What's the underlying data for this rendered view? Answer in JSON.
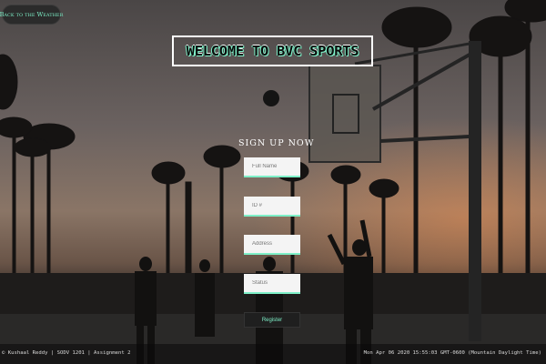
{
  "nav": {
    "back_label": "Back to the Weather"
  },
  "header": {
    "title": "WELCOME TO BVC SPORTS"
  },
  "form": {
    "title": "SIGN UP NOW",
    "fields": [
      {
        "placeholder": "Full Name",
        "value": ""
      },
      {
        "placeholder": "ID #",
        "value": ""
      },
      {
        "placeholder": "Address",
        "value": ""
      },
      {
        "placeholder": "Status",
        "value": ""
      }
    ],
    "register_label": "Register"
  },
  "footer": {
    "credit": "© Kushaal Reddy | SODV 1201 | Assignment 2",
    "datetime": "Mon Apr 06 2020 15:55:03 GMT-0600 (Mountain Daylight Time)"
  },
  "colors": {
    "accent": "#7ef0c8",
    "button_bg": "#2b2b2b"
  }
}
